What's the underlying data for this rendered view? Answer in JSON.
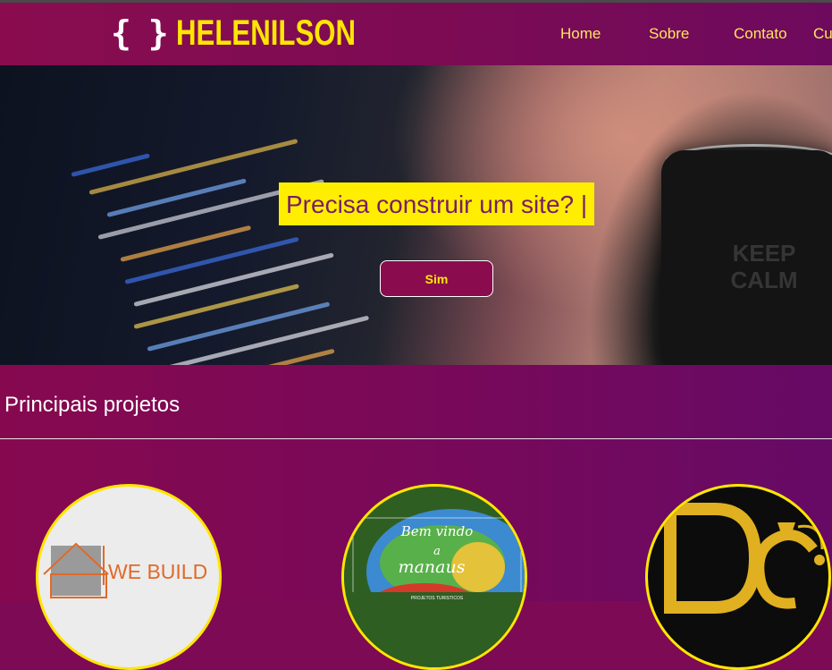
{
  "header": {
    "brand_braces": "{ }",
    "brand_name": "HELENILSON",
    "nav": [
      {
        "label": "Home"
      },
      {
        "label": "Sobre"
      },
      {
        "label": "Contato"
      },
      {
        "label": "Cur"
      }
    ]
  },
  "hero": {
    "typed_text": "Precisa construir um site? |",
    "button_label": "Sim",
    "mug_text": "KEEP CALM"
  },
  "projects": {
    "title": "Principais projetos",
    "items": [
      {
        "logo_text": "WE BUILD"
      },
      {
        "line1": "Bem vindo",
        "line2": "a",
        "line3": "manaus",
        "footer": "PROJETOS TURISTICOS"
      },
      {
        "logo_text": "DC"
      }
    ]
  },
  "colors": {
    "accent_yellow": "#ffe600",
    "brand_magenta": "#8a0c4f",
    "text_white": "#ffffff"
  }
}
